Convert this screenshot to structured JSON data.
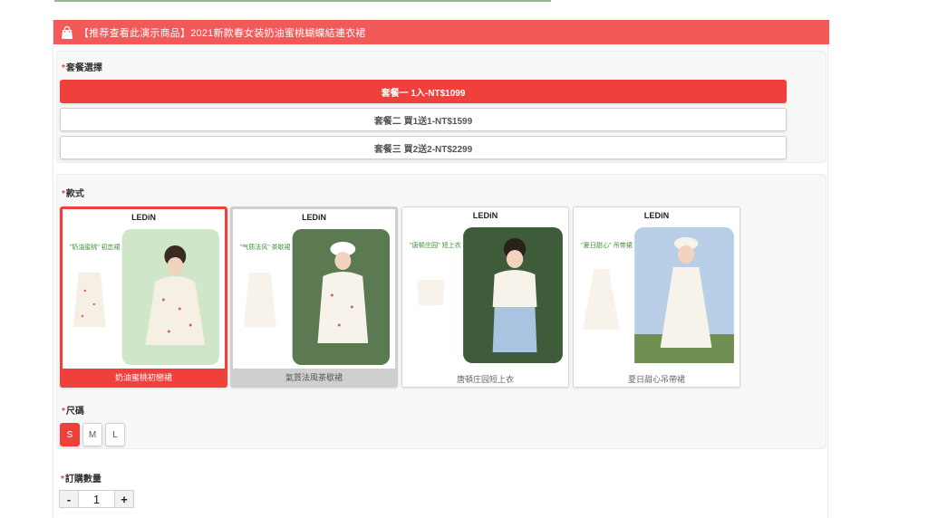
{
  "banner": {
    "icon": "shopping-bag-icon",
    "text": "【推荐查看此演示商品】2021新款春女装奶油蜜桃蝴蝶結連衣裙"
  },
  "plan": {
    "label": "套餐選擇",
    "required_mark": "*",
    "options": [
      {
        "label": "套餐一 1入-NT$1099",
        "selected": true
      },
      {
        "label": "套餐二 買1送1-NT$1599",
        "selected": false
      },
      {
        "label": "套餐三 買2送2-NT$2299",
        "selected": false
      }
    ]
  },
  "style": {
    "label": "款式",
    "required_mark": "*",
    "options": [
      {
        "caption": "奶油蜜桃初戀裙",
        "brand": "LEDiN",
        "tag": "\"奶油蜜桃\" 初恋裙",
        "bg": "#cfe6c9",
        "selected": true
      },
      {
        "caption": "氣質法風茶歇裙",
        "brand": "LEDiN",
        "tag": "\"气质法风\" 茶歇裙",
        "bg": "#5c7a52",
        "selected": false
      },
      {
        "caption": "唐頓庄园短上衣",
        "brand": "LEDiN",
        "tag": "\"唐顿庄园\" 短上衣",
        "bg": "#3f5c3a",
        "selected": false
      },
      {
        "caption": "夏日甜心吊帶裙",
        "brand": "LEDiN",
        "tag": "\"夏日甜心\" 吊带裙",
        "bg": "#b9cfe8",
        "selected": false
      }
    ]
  },
  "size": {
    "label": "尺碼",
    "required_mark": "*",
    "options": [
      {
        "label": "S",
        "selected": true
      },
      {
        "label": "M",
        "selected": false
      },
      {
        "label": "L",
        "selected": false
      }
    ]
  },
  "quantity": {
    "label": "訂購數量",
    "required_mark": "*",
    "minus": "-",
    "value": "1",
    "plus": "+"
  },
  "colors": {
    "accent": "#f0403c",
    "banner": "#f25a5a"
  }
}
